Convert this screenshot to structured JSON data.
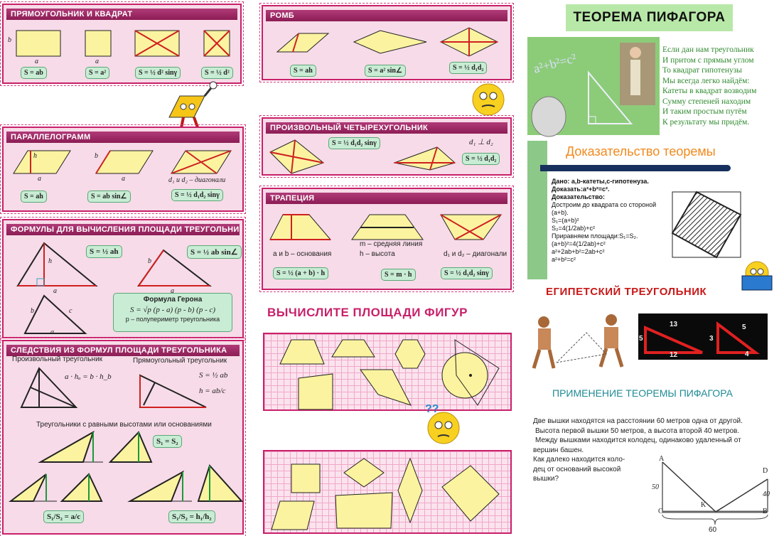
{
  "left": {
    "rect": {
      "title": "ПРЯМОУГОЛЬНИК И КВАДРАТ",
      "labels": [
        "b",
        "a",
        "a"
      ],
      "formulas": [
        "S = ab",
        "S = a²",
        "S = ½ d² sinγ",
        "S = ½ d²"
      ]
    },
    "parallelogram": {
      "title": "ПАРАЛЛЕЛОГРАММ",
      "labels": [
        "h",
        "a",
        "b",
        "a",
        "d₁ и d₂ – диагонали"
      ],
      "formulas": [
        "S = ah",
        "S = ab sin∠",
        "S = ½ d₁d₂ sinγ"
      ]
    },
    "triangle": {
      "title": "ФОРМУЛЫ ДЛЯ ВЫЧИСЛЕНИЯ ПЛОЩАДИ ТРЕУГОЛЬНИКА",
      "labels": [
        "h",
        "a",
        "b",
        "a",
        "b",
        "c",
        "a"
      ],
      "formulas": [
        "S = ½ ah",
        "S = ½ ab sin∠"
      ],
      "heron_title": "Формула Герона",
      "heron_formula": "S = √p (p - a) (p - b) (p - c)",
      "heron_note": "p – полупериметр треугольника"
    },
    "corollaries": {
      "title": "СЛЕДСТВИЯ ИЗ ФОРМУЛ ПЛОЩАДИ ТРЕУГОЛЬНИКА",
      "arbitrary": "Произвольный треугольник",
      "arbitrary_formula": "a · hₐ = b · h_b",
      "right": "Прямоугольный треугольник",
      "right_f1": "S = ½ ab",
      "right_f2": "h = ab/c",
      "equal": "Треугольники с равными  высотами или основаниями",
      "f_equal": "S₁ = S₂",
      "f_ratio1": "S₁/S₂ = a/c",
      "f_ratio2": "S₁/S₂ = h₁/h₂"
    }
  },
  "middle": {
    "rhombus": {
      "title": "РОМБ",
      "formulas": [
        "S = ah",
        "S = a² sin∠",
        "S = ½ d₁d₂"
      ]
    },
    "quad": {
      "title": "ПРОИЗВОЛЬНЫЙ ЧЕТЫРЕХУГОЛЬНИК",
      "formulas": [
        "S = ½ d₁d₂ sinγ",
        "S = ½ d₁d₂"
      ],
      "perp": "d₁ ⊥ d₂"
    },
    "trapezoid": {
      "title": "ТРАПЕЦИЯ",
      "notes": [
        "a и b – основания",
        "m – средняя линия",
        "h – высота",
        "d₁ и d₂ – диагонали"
      ],
      "formulas": [
        "S = ½ (a + b) · h",
        "S = m · h",
        "S = ½ d₁d₂ sinγ"
      ]
    },
    "exercise_title": "ВЫЧИСЛИТЕ ПЛОЩАДИ ФИГУР"
  },
  "right": {
    "title": "ТЕОРЕМА ПИФАГОРА",
    "image_formula": "a²+b²=c²",
    "poem": [
      "Если дан нам треугольник",
      "И притом с прямым углом",
      "То квадрат гипотенузы",
      "Мы всегда легко найдём:",
      "Катеты в квадрат возводим",
      "Сумму степеней находим",
      "И таким простым путём",
      "К результату мы придём."
    ],
    "proof_title": "Доказательство теоремы",
    "proof": [
      "Дано: a,b-катеты,c-гипотенуза.",
      "Доказать:a²+b²=c².",
      "Доказательство:",
      "Достроим до квадрата со стороной (a+b).",
      "S₁=(a+b)²",
      "S₂=4(1/2ab)+c²",
      "Приравняем площади:S₁=S₂.",
      "(a+b)²=4(1/2ab)+c²",
      "a²+2ab+b²=2ab+c²",
      "a²+b²=c²"
    ],
    "egypt_title": "ЕГИПЕТСКИЙ ТРЕУГОЛЬНИК",
    "egypt_numbers": [
      "13",
      "5",
      "12",
      "3",
      "5",
      "4"
    ],
    "application_title": "ПРИМЕНЕНИЕ ТЕОРЕМЫ ПИФАГОРА",
    "problem": [
      "Две вышки находятся на расстоянии 60 метров одна от другой.",
      "Высота первой вышки 50 метров, а высота второй 40 метров.",
      "Между вышками находится колодец, одинаково удаленный от",
      "вершин башен.",
      "Как далеко находится коло-",
      "дец от оснований высокой",
      "вышки?"
    ],
    "diagram_labels": [
      "A",
      "D",
      "50",
      "40",
      "K",
      "C",
      "B",
      "60"
    ]
  },
  "colors": {
    "accent": "#c8206a",
    "formula_bg": "#c8ecd4",
    "fill_yellow": "#fbf3a0",
    "green_text": "#2f8a2f",
    "orange": "#f08a1e",
    "teal": "#1f8a95"
  }
}
